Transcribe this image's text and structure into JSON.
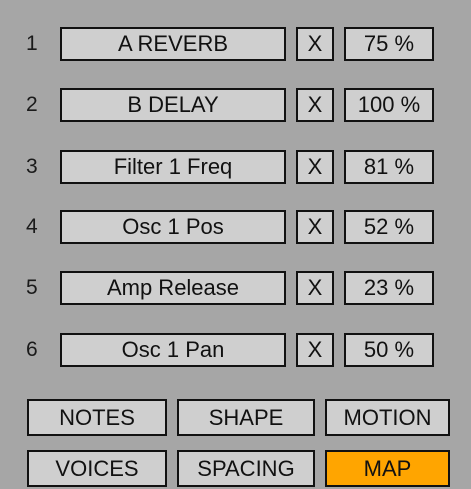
{
  "slots": [
    {
      "num": "1",
      "param": "A REVERB",
      "clear": "X",
      "value": "75 %"
    },
    {
      "num": "2",
      "param": "B DELAY",
      "clear": "X",
      "value": "100 %"
    },
    {
      "num": "3",
      "param": "Filter 1 Freq",
      "clear": "X",
      "value": "81 %"
    },
    {
      "num": "4",
      "param": "Osc 1 Pos",
      "clear": "X",
      "value": "52 %"
    },
    {
      "num": "5",
      "param": "Amp Release",
      "clear": "X",
      "value": "23 %"
    },
    {
      "num": "6",
      "param": "Osc 1 Pan",
      "clear": "X",
      "value": "50 %"
    }
  ],
  "modes": {
    "notes": "NOTES",
    "shape": "SHAPE",
    "motion": "MOTION",
    "voices": "VOICES",
    "spacing": "SPACING",
    "map": "MAP"
  },
  "colors": {
    "background": "#a6a6a6",
    "button": "#cfcfcf",
    "active": "#ffa500"
  }
}
